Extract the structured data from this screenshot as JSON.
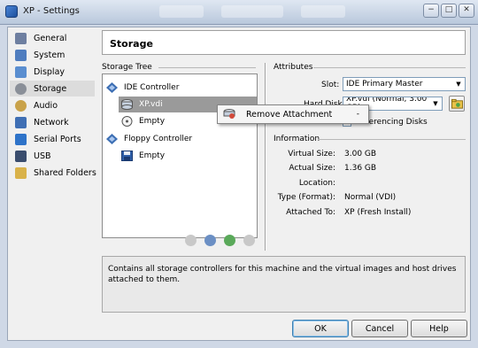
{
  "window": {
    "title": "XP - Settings",
    "close_glyph": "✕",
    "minimize_glyph": "−",
    "maximize_glyph": "□"
  },
  "sidebar": {
    "items": [
      {
        "label": "General",
        "icon": "general-icon",
        "color": "#6e7fa0"
      },
      {
        "label": "System",
        "icon": "system-icon",
        "color": "#4f7dbf"
      },
      {
        "label": "Display",
        "icon": "display-icon",
        "color": "#5a8ed0"
      },
      {
        "label": "Storage",
        "icon": "storage-icon",
        "color": "#8a8f98",
        "selected": true
      },
      {
        "label": "Audio",
        "icon": "audio-icon",
        "color": "#c9a24a"
      },
      {
        "label": "Network",
        "icon": "network-icon",
        "color": "#3f6fb4"
      },
      {
        "label": "Serial Ports",
        "icon": "serial-ports-icon",
        "color": "#2e73c9"
      },
      {
        "label": "USB",
        "icon": "usb-icon",
        "color": "#3a4d6e"
      },
      {
        "label": "Shared Folders",
        "icon": "shared-folders-icon",
        "color": "#d9b24a"
      }
    ]
  },
  "page_title": "Storage",
  "storage_tree": {
    "heading": "Storage Tree",
    "rows": [
      {
        "label": "IDE Controller",
        "icon": "ide-controller-icon"
      },
      {
        "label": "XP.vdi",
        "icon": "hard-disk-icon",
        "selected": true
      },
      {
        "label": "Empty",
        "icon": "cd-drive-icon"
      },
      {
        "label": "Floppy Controller",
        "icon": "floppy-controller-icon"
      },
      {
        "label": "Empty",
        "icon": "floppy-drive-icon"
      }
    ]
  },
  "attributes": {
    "heading": "Attributes",
    "slot_label": "Slot:",
    "slot_value": "IDE Primary Master",
    "hard_disk_label": "Hard Disk:",
    "hard_disk_value": "XP.vdi (Normal, 3.00 GB)",
    "checkbox_label": "Differencing Disks"
  },
  "context_menu": {
    "item": "Remove Attachment",
    "shortcut": "-"
  },
  "information": {
    "heading": "Information",
    "rows": [
      {
        "label": "Virtual Size:",
        "value": "3.00 GB"
      },
      {
        "label": "Actual Size:",
        "value": "1.36 GB"
      },
      {
        "label": "Location:",
        "value": ""
      },
      {
        "label": "Type (Format):",
        "value": "Normal (VDI)"
      },
      {
        "label": "Attached To:",
        "value": "XP (Fresh Install)"
      }
    ]
  },
  "description": "Contains all storage controllers for this machine and the virtual images and host drives attached to them.",
  "buttons": {
    "ok": "OK",
    "cancel": "Cancel",
    "help": "Help"
  },
  "colors": {
    "selection": "#9a9a9a",
    "accent": "#3c7fb1",
    "background": "#f0f0f0"
  }
}
